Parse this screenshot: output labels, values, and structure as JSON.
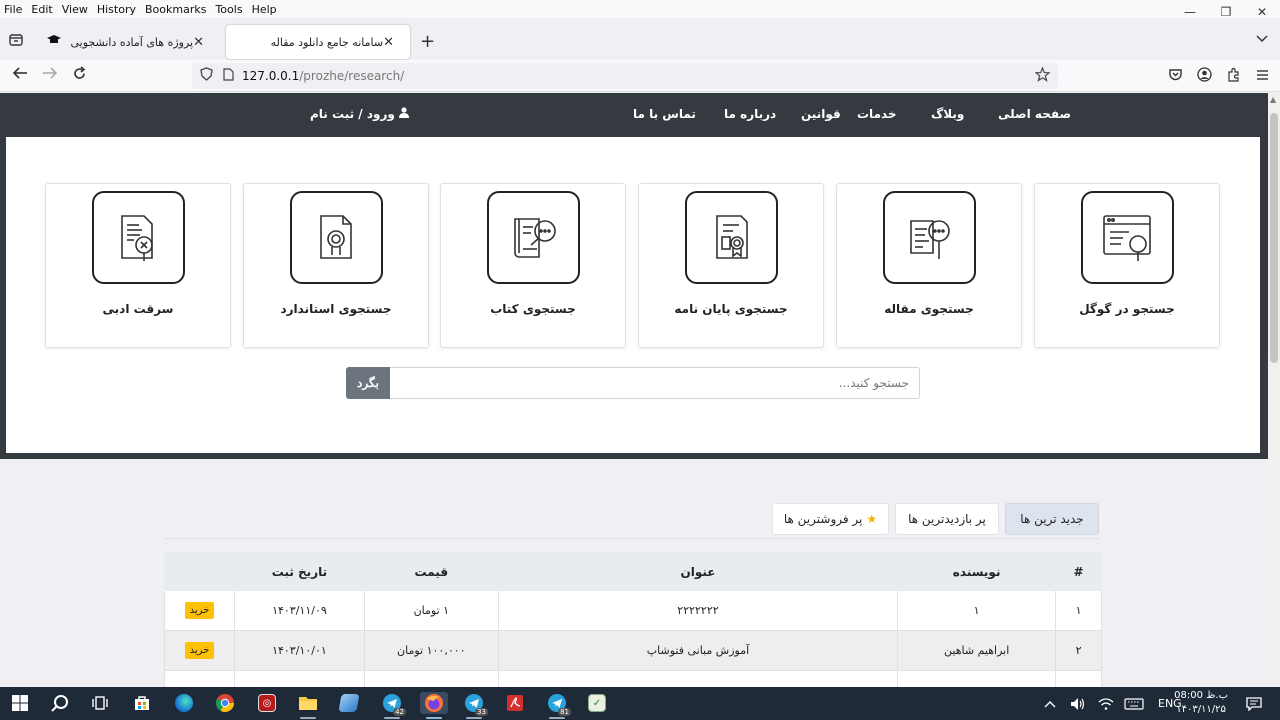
{
  "menubar": {
    "items": [
      "File",
      "Edit",
      "View",
      "History",
      "Bookmarks",
      "Tools",
      "Help"
    ]
  },
  "window_controls": {
    "minimize": "—",
    "restore": "❐",
    "close": "✕"
  },
  "tabs": [
    {
      "title": "پروژه های آماده دانشجویی",
      "close": "✕"
    },
    {
      "title": "سامانه جامع دانلود مقاله",
      "close": "✕"
    }
  ],
  "newtab": "+",
  "address": {
    "host": "127.0.0.1",
    "path": "/prozhe/research/"
  },
  "site_nav": {
    "links": [
      "صفحه اصلی",
      "وبلاگ",
      "خدمات",
      "قوانین",
      "درباره ما",
      "تماس با ما"
    ],
    "login": "ورود / ثبت نام"
  },
  "cards": [
    {
      "label": "جستجو در گوگل",
      "icon": "google-search-icon"
    },
    {
      "label": "جستجوی مقاله",
      "icon": "article-search-icon"
    },
    {
      "label": "جستجوی پایان نامه",
      "icon": "thesis-certificate-icon"
    },
    {
      "label": "جستجوی کتاب",
      "icon": "book-search-icon"
    },
    {
      "label": "جستجوی استاندارد",
      "icon": "standard-document-icon"
    },
    {
      "label": "سرقت ادبی",
      "icon": "plagiarism-icon"
    }
  ],
  "search": {
    "placeholder": "جستجو کنید...",
    "button": "بگرد"
  },
  "product_tabs": {
    "newest": "جدید ترین ها",
    "most_viewed": "پر بازدیدترین ها",
    "best_selling": "پر فروشترین ها"
  },
  "table": {
    "headers": [
      "#",
      "نویسنده",
      "عنوان",
      "قیمت",
      "تاریخ ثبت",
      ""
    ],
    "rows": [
      {
        "num": "۱",
        "author": "۱",
        "title": "۲۲۲۲۲۲۲",
        "price": "۱ تومان",
        "date": "۱۴۰۳/۱۱/۰۹",
        "buy": "خرید"
      },
      {
        "num": "۲",
        "author": "ابراهیم شاهین",
        "title": "آموزش مبانی فتوشاپ",
        "price": "۱۰۰,۰۰۰ تومان",
        "date": "۱۴۰۳/۱۰/۰۱",
        "buy": "خرید"
      }
    ]
  },
  "taskbar": {
    "badges": {
      "telegram1": "42",
      "telegram2": "33",
      "telegram3": "81"
    },
    "lang": "ENG",
    "time": "ب.ظ 08:00",
    "date": "۱۴۰۳/۱۱/۲۵"
  }
}
